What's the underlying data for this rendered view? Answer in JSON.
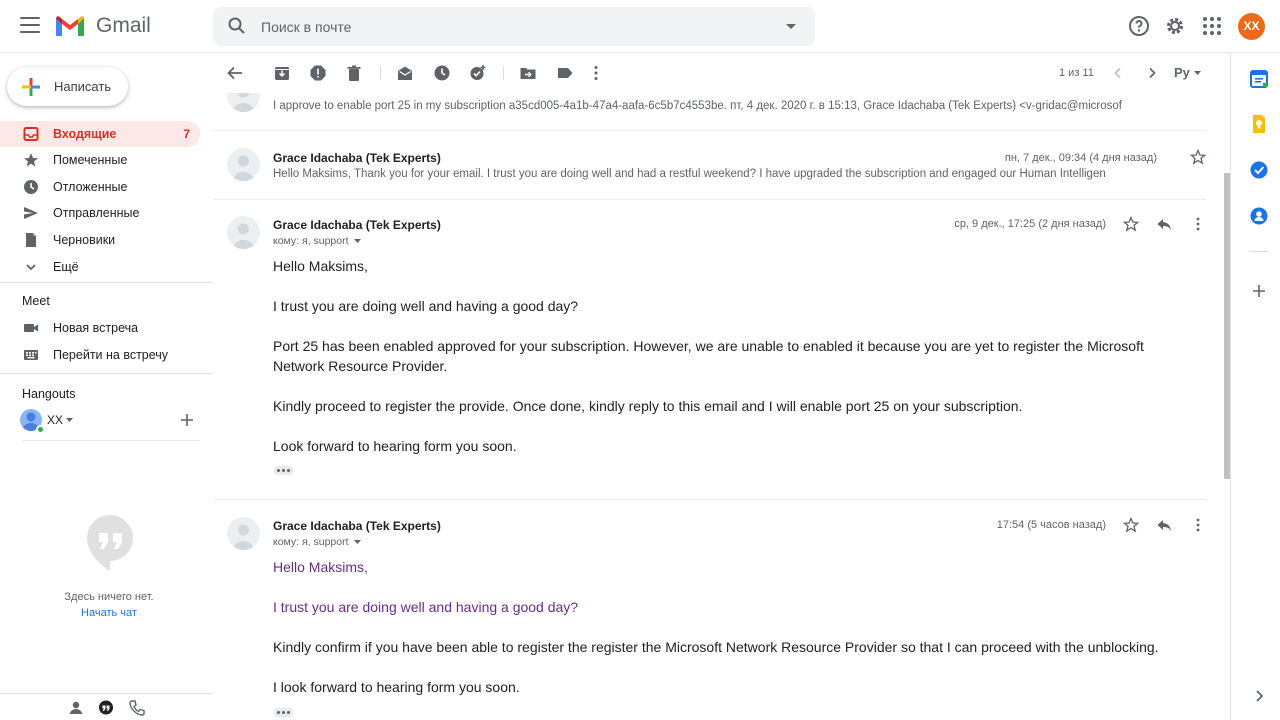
{
  "header": {
    "brand": "Gmail",
    "search_placeholder": "Поиск в почте",
    "avatar_initials": "XX"
  },
  "leftnav": {
    "compose_label": "Написать",
    "items": [
      {
        "label": "Входящие",
        "count": "7",
        "icon": "inbox-icon",
        "active": true
      },
      {
        "label": "Помеченные",
        "icon": "star-icon"
      },
      {
        "label": "Отложенные",
        "icon": "clock-icon"
      },
      {
        "label": "Отправленные",
        "icon": "send-icon"
      },
      {
        "label": "Черновики",
        "icon": "draft-icon"
      },
      {
        "label": "Ещё",
        "icon": "chevron-down-icon"
      }
    ],
    "meet": {
      "title": "Meet",
      "items": [
        {
          "label": "Новая встреча",
          "icon": "video-icon"
        },
        {
          "label": "Перейти на встречу",
          "icon": "keyboard-icon"
        }
      ]
    },
    "hangouts": {
      "title": "Hangouts",
      "user_name": "XX",
      "empty_text": "Здесь ничего нет.",
      "start_chat": "Начать чат"
    }
  },
  "toolbar": {
    "pager": "1 из 11",
    "lang": "Ру"
  },
  "thread": {
    "collapsed": [
      {
        "sender": "",
        "snippet": "I approve to enable port 25 in my subscription a35cd005-4a1b-47a4-aafa-6c5b7c4553be. пт, 4 дек. 2020 г. в 15:13, Grace Idachaba (Tek Experts) <v-gridac@microsof",
        "date": ""
      },
      {
        "sender": "Grace Idachaba (Tek Experts)",
        "snippet": "Hello Maksims, Thank you for your email. I trust you are doing well and had a restful weekend? I have upgraded the subscription and engaged our Human Intelligen",
        "date": "пн, 7 дек., 09:34 (4 дня назад)"
      }
    ],
    "expanded": [
      {
        "sender": "Grace Idachaba (Tek Experts)",
        "to": "кому: я, support",
        "date": "ср, 9 дек., 17:25 (2 дня назад)",
        "paragraphs": [
          "Hello Maksims,",
          "I trust you are doing well and having a good day?",
          "Port 25 has been enabled approved for your subscription. However, we are unable to enabled it because you are yet to register the Microsoft Network Resource Provider.",
          "Kindly proceed to register the provide. Once done, kindly reply to this email and I will enable port 25 on your subscription.",
          "Look forward to hearing form you soon."
        ]
      },
      {
        "sender": "Grace Idachaba (Tek Experts)",
        "to": "кому: я, support",
        "date": "17:54 (5 часов назад)",
        "paragraphs": [
          "Hello Maksims,",
          "I trust you are doing well and having a good day?",
          "Kindly confirm if you have been able to register the register the Microsoft Network Resource Provider so that I can proceed with the unblocking.",
          "I look forward to hearing form you soon."
        ]
      }
    ]
  },
  "colors": {
    "accent_red": "#d93025",
    "active_bg": "#fce8e6",
    "link_blue": "#1a73e8",
    "quoted_purple": "#6b2c85",
    "avatar_orange": "#ea6b1a"
  }
}
